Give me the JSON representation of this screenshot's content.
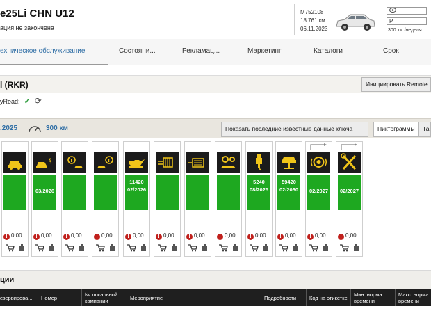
{
  "header": {
    "model": "e25Li CHN U12",
    "status": "ация не закончена",
    "vehicle_id": "M752108",
    "mileage": "18 761 км",
    "date": "06.11.2023",
    "rate": "300 км /неделя",
    "box1_icon": "eye-icon",
    "box2_label": "P"
  },
  "nav": {
    "tabs": [
      "ехническое обслуживание",
      "Состояни...",
      "Рекламац...",
      "Маркетинг",
      "Каталоги",
      "Срок"
    ]
  },
  "section": {
    "title": "l (RKR)",
    "init_button": "Инициировать Remote",
    "read_label": "yRead:"
  },
  "datebar": {
    "date": ".2025",
    "km": "300 км",
    "show_button": "Показать последние известные данные ключа",
    "pictograms_tab": "Пиктограммы",
    "table_tab": "Та"
  },
  "cards": [
    {
      "icon": "car-lift-icon",
      "line1": "",
      "line2": "",
      "cost": "0,00",
      "flag": false
    },
    {
      "icon": "car-inspection-icon",
      "line1": "",
      "line2": "03/2026",
      "cost": "0,00",
      "flag": false
    },
    {
      "icon": "brake-front-icon",
      "line1": "",
      "line2": "",
      "cost": "0,00",
      "flag": false
    },
    {
      "icon": "brake-rear-icon",
      "line1": "",
      "line2": "",
      "cost": "0,00",
      "flag": false
    },
    {
      "icon": "oil-can-icon",
      "line1": "11420",
      "line2": "02/2026",
      "cost": "0,00",
      "flag": false
    },
    {
      "icon": "microfilter-icon",
      "line1": "",
      "line2": "",
      "cost": "0,00",
      "flag": false
    },
    {
      "icon": "air-filter-icon",
      "line1": "",
      "line2": "",
      "cost": "0,00",
      "flag": false
    },
    {
      "icon": "engine-gears-icon",
      "line1": "",
      "line2": "",
      "cost": "0,00",
      "flag": false
    },
    {
      "icon": "spark-plug-icon",
      "line1": "5240",
      "line2": "08/2025",
      "cost": "0,00",
      "flag": false
    },
    {
      "icon": "vehicle-check-icon",
      "line1": "59420",
      "line2": "02/2030",
      "cost": "0,00",
      "flag": false
    },
    {
      "icon": "brake-fluid-icon",
      "line1": "",
      "line2": "02/2027",
      "cost": "0,00",
      "flag": true
    },
    {
      "icon": "wrench-screwdriver-icon",
      "line1": "",
      "line2": "02/2027",
      "cost": "0,00",
      "flag": true
    }
  ],
  "campaigns": {
    "title": "ции",
    "columns": [
      "езервирова...",
      "Номер",
      "№ локальной кампании",
      "Мероприятие",
      "Подробности",
      "Код на этикетке",
      "Мин. норма времени",
      "Макс. норма времени"
    ]
  },
  "colors": {
    "accent": "#2f6ea5",
    "green": "#1ea820",
    "dark": "#1b1b1b",
    "warning": "#c0201c"
  }
}
